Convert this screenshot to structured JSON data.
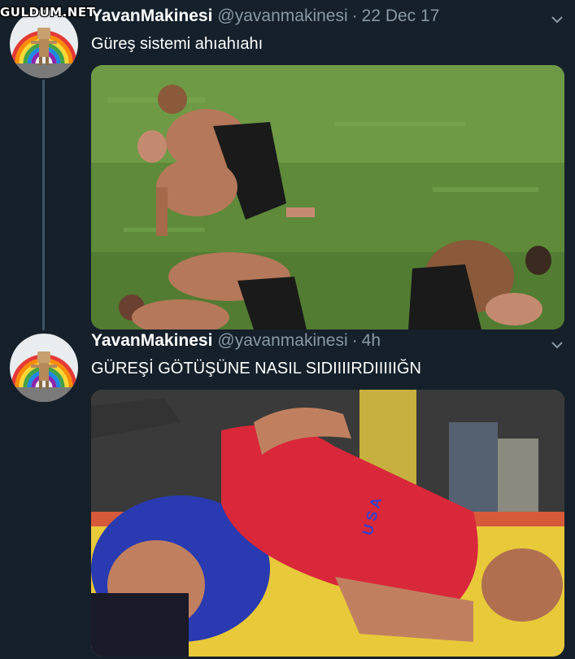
{
  "watermark": {
    "text": "GULDUM.NET"
  },
  "tweets": [
    {
      "name": "YavanMakinesi",
      "handle": "@yavanmakinesi",
      "separator": "·",
      "time": "22 Dec 17",
      "text": "Güreş sistemi ahıahıahı",
      "media": {
        "description": "oil wrestlers on grass",
        "icon": "photo"
      }
    },
    {
      "name": "YavanMakinesi",
      "handle": "@yavanmakinesi",
      "separator": "·",
      "time": "4h",
      "text": "GÜREŞİ GÖTÜŞÜNE NASIL SIDIIIIRDIIIIIĞN",
      "media": {
        "jersey_letters": "USA",
        "icon": "photo"
      }
    }
  ],
  "colors": {
    "background": "#15202b",
    "secondary_text": "#8899a6",
    "thread_line": "#3d5466"
  }
}
